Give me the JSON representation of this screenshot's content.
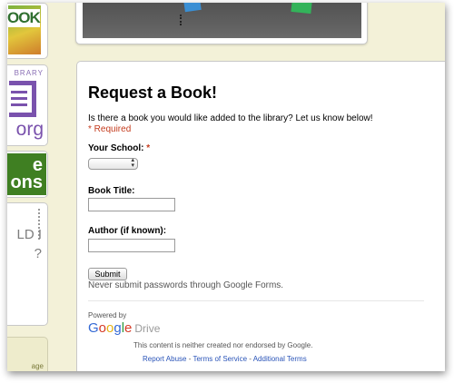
{
  "sidebar": {
    "book_logo_text": "OOK",
    "library_top_text": "BRARY",
    "library_org_text": "org",
    "lessons_text": "e\nons",
    "text_fragment": "LD I\n?",
    "bottom_fragment": "age"
  },
  "form": {
    "title": "Request a Book!",
    "description": "Is there a book you would like added to the library? Let us know below!",
    "required_note": "* Required",
    "questions": {
      "school": {
        "label": "Your School:",
        "required_mark": "*",
        "selected": ""
      },
      "book_title": {
        "label": "Book Title:",
        "value": ""
      },
      "author": {
        "label": "Author (if known):",
        "value": ""
      }
    },
    "submit_label": "Submit",
    "password_warning": "Never submit passwords through Google Forms."
  },
  "footer": {
    "powered_by": "Powered by",
    "google_letters": [
      "G",
      "o",
      "o",
      "g",
      "l",
      "e"
    ],
    "drive_label": "Drive",
    "disclaimer": "This content is neither created nor endorsed by Google.",
    "links": {
      "report_abuse": "Report Abuse",
      "separator": " - ",
      "terms": "Terms of Service",
      "additional_terms": "Additional Terms"
    }
  },
  "colors": {
    "sidebar_bg": "#f3f1d8",
    "required_red": "#c43b1d",
    "link_blue": "#2a54b8",
    "library_purple": "#7a52ad",
    "lessons_green": "#3f7f22"
  },
  "icons": {
    "select_arrows": "updown-arrows-icon"
  }
}
